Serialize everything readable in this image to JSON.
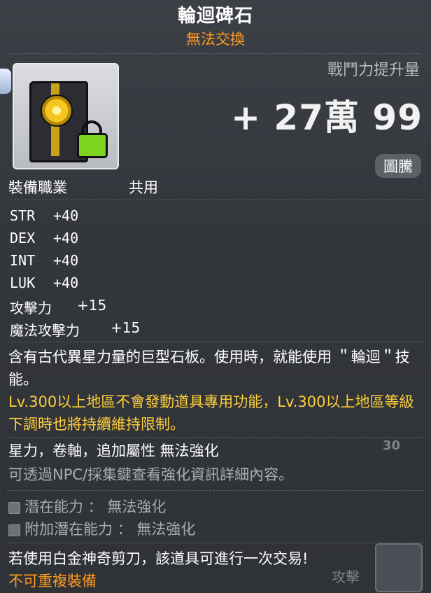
{
  "item": {
    "name": "輪迴碑石",
    "trade_status": "無法交換",
    "combat_power_label": "戰鬥力提升量",
    "combat_power_value": "+ 27萬 99",
    "badge": "圖騰",
    "job_label": "裝備職業",
    "job_value": "共用"
  },
  "stats": [
    {
      "name": "STR",
      "value": "+40"
    },
    {
      "name": "DEX",
      "value": "+40"
    },
    {
      "name": "INT",
      "value": "+40"
    },
    {
      "name": "LUK",
      "value": "+40"
    },
    {
      "name": "攻擊力",
      "value": "+15"
    },
    {
      "name": "魔法攻擊力",
      "value": "+15"
    }
  ],
  "description": "含有古代異星力量的巨型石板。使用時，就能使用 ＂輪迴＂技能。",
  "warning": "Lv.300以上地區不會發動道具專用功能，Lv.300以上地區等級下調時也將持續維持限制。",
  "enhancement": {
    "title": "星力，卷軸，追加屬性 無法強化",
    "note": "可透過NPC/採集鍵查看強化資訊詳細內容。"
  },
  "potentials": [
    {
      "label": "潛在能力 ： 無法強化"
    },
    {
      "label": "附加潛在能力 ： 無法強化"
    }
  ],
  "footer": {
    "note": "若使用白金神奇剪刀，該道具可進行一次交易!",
    "restriction": "不可重複裝備"
  },
  "background": {
    "number": "30",
    "attack_label": "攻擊"
  },
  "colors": {
    "title": "#ffffff",
    "accent_orange": "#ff9a1e",
    "warning_yellow": "#ffcf3a",
    "muted_gray": "#a9adb3",
    "lock_green": "#7ed321"
  },
  "icons": {
    "item": "stone-tablet-icon",
    "lock": "lock-icon"
  }
}
